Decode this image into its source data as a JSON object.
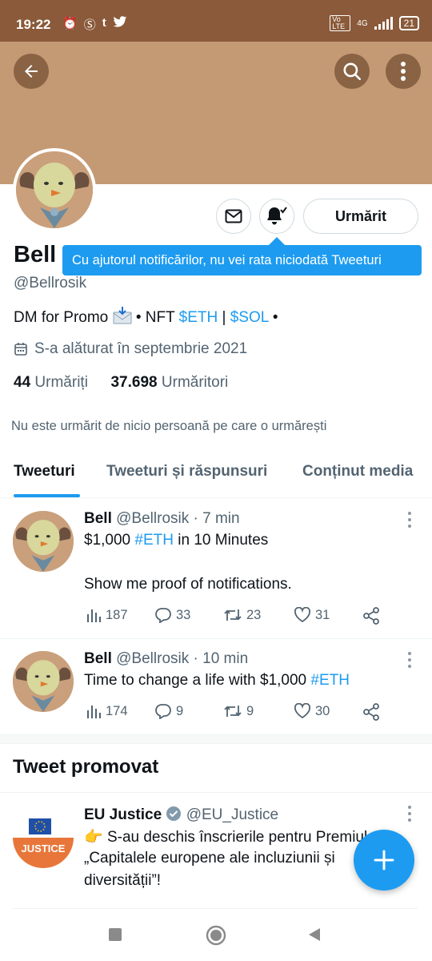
{
  "status_bar": {
    "time": "19:22",
    "network": "4G",
    "volte": "Vo LTE",
    "battery": "21"
  },
  "profile": {
    "name": "Bell",
    "handle": "@Bellrosik",
    "follow_button": "Urmărit",
    "tooltip": "Cu ajutorul notificărilor, nu vei rata niciodată Tweeturi",
    "bio": {
      "part1": "DM for Promo",
      "part2": "• NFT",
      "eth": "$ETH",
      "sep": "|",
      "sol": "$SOL",
      "end": "•"
    },
    "joined": "S-a alăturat în septembrie 2021",
    "following_count": "44",
    "following_label": "Urmăriți",
    "followers_count": "37.698",
    "followers_label": "Urmăritori",
    "not_followed": "Nu este urmărit de nicio persoană pe care o urmărești"
  },
  "tabs": [
    {
      "label": "Tweeturi",
      "active": true
    },
    {
      "label": "Tweeturi și răspunsuri",
      "active": false
    },
    {
      "label": "Conținut media",
      "active": false
    }
  ],
  "tweets": [
    {
      "name": "Bell",
      "handle": "@Bellrosik",
      "time": "· 7 min",
      "line1_a": "$1,000",
      "line1_tag": "#ETH",
      "line1_b": "in 10 Minutes",
      "line2": "Show me proof of notifications.",
      "views": "187",
      "replies": "33",
      "retweets": "23",
      "likes": "31"
    },
    {
      "name": "Bell",
      "handle": "@Bellrosik",
      "time": "· 10 min",
      "line1_a": "Time to change a life with $1,000",
      "line1_tag": "#ETH",
      "views": "174",
      "replies": "9",
      "retweets": "9",
      "likes": "30"
    }
  ],
  "promoted": {
    "section_title": "Tweet promovat",
    "name": "EU Justice",
    "handle": "@EU_Justice",
    "logo_text": "JUSTICE",
    "line1": "S-au deschis înscrierile pentru Premiul",
    "line2": "„Capitalele europene ale incluziunii și",
    "line3": "diversității”!"
  },
  "colors": {
    "accent": "#1d9bf0",
    "banner": "#c49a74",
    "statusbar": "#8a5a3a",
    "muted": "#536471"
  }
}
